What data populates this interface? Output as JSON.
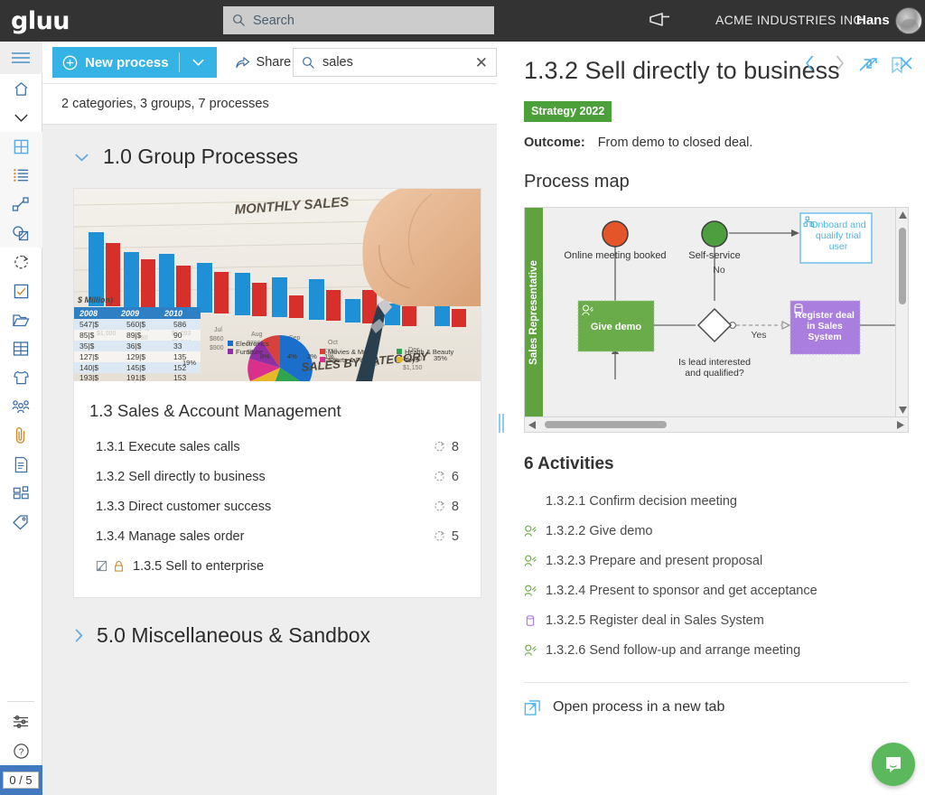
{
  "topbar": {
    "logo": "gluu",
    "search_placeholder": "Search",
    "company": "ACME INDUSTRIES INC.",
    "username": "Hans"
  },
  "rail": {
    "items": [
      {
        "name": "menu-toggle",
        "icon": "hamburger-icon"
      },
      {
        "name": "home",
        "icon": "home-icon"
      },
      {
        "name": "collapse",
        "icon": "chevron-down-icon"
      },
      {
        "name": "processes-grid",
        "icon": "grid-icon"
      },
      {
        "name": "list",
        "icon": "list-icon"
      },
      {
        "name": "flow",
        "icon": "flow-icon"
      },
      {
        "name": "objects",
        "icon": "shapes-icon"
      },
      {
        "name": "activity-cycle",
        "icon": "circular-arrow-icon"
      },
      {
        "name": "tasks",
        "icon": "checkbox-icon"
      },
      {
        "name": "folders",
        "icon": "folder-icon"
      },
      {
        "name": "library",
        "icon": "drawer-icon"
      },
      {
        "name": "roles",
        "icon": "shirt-icon"
      },
      {
        "name": "people",
        "icon": "people-icon"
      },
      {
        "name": "attachments",
        "icon": "paperclip-icon"
      },
      {
        "name": "documents",
        "icon": "document-icon"
      },
      {
        "name": "modules",
        "icon": "modules-icon"
      },
      {
        "name": "tags",
        "icon": "tag-icon"
      }
    ],
    "bottom": [
      {
        "name": "settings",
        "icon": "sliders-icon"
      },
      {
        "name": "help",
        "icon": "question-circle-icon"
      }
    ],
    "counter": "0 / 5"
  },
  "toolbar": {
    "new_process": "New process",
    "share": "Share",
    "search_value": "sales"
  },
  "list": {
    "summary": "2 categories, 3 groups, 7 processes",
    "categories": [
      {
        "id": "cat-1",
        "title": "1.0 Group Processes",
        "expanded": true,
        "groups": [
          {
            "title": "1.3 Sales & Account Management",
            "image_alt": "MONTHLY SALES bar chart with pen",
            "processes": [
              {
                "title": "1.3.1 Execute sales calls",
                "count": "8",
                "locked": false,
                "draft": false
              },
              {
                "title": "1.3.2 Sell directly to business",
                "count": "6",
                "locked": false,
                "draft": false
              },
              {
                "title": "1.3.3 Direct customer success",
                "count": "8",
                "locked": false,
                "draft": false
              },
              {
                "title": "1.3.4 Manage sales order",
                "count": "5",
                "locked": false,
                "draft": false
              },
              {
                "title": "1.3.5 Sell to enterprise",
                "count": "",
                "locked": true,
                "draft": true
              }
            ]
          }
        ]
      },
      {
        "id": "cat-5",
        "title": "5.0 Miscellaneous & Sandbox",
        "expanded": false,
        "groups": []
      }
    ]
  },
  "detail": {
    "title": "1.3.2 Sell directly to business",
    "badge": "Strategy 2022",
    "outcome_label": "Outcome:",
    "outcome_text": "From demo to closed deal.",
    "map_title": "Process map",
    "activities_title": "6 Activities",
    "activities": [
      {
        "num_title": "1.3.2.1 Confirm decision meeting",
        "icon": "none"
      },
      {
        "num_title": "1.3.2.2 Give demo",
        "icon": "user-task-icon"
      },
      {
        "num_title": "1.3.2.3 Prepare and present proposal",
        "icon": "user-task-icon"
      },
      {
        "num_title": "1.3.2.4 Present to sponsor and get acceptance",
        "icon": "user-task-icon"
      },
      {
        "num_title": "1.3.2.5 Register deal in Sales System",
        "icon": "system-task-icon"
      },
      {
        "num_title": "1.3.2.6 Send follow-up and arrange meeting",
        "icon": "user-task-icon"
      }
    ],
    "open_in_new_tab": "Open process in a new tab",
    "nav": {
      "prev": "prev",
      "next": "next",
      "expand": "expand",
      "close": "close"
    }
  },
  "process_map": {
    "lane": "Sales Representative",
    "nodes": [
      {
        "id": "start1",
        "type": "start-event",
        "label": "Online meeting booked",
        "color": "#e4562a"
      },
      {
        "id": "start2",
        "type": "start-event",
        "label": "Self-service",
        "color": "#4d9e3f"
      },
      {
        "id": "task1",
        "type": "user-task",
        "label": "Give demo",
        "color": "#6aab4a"
      },
      {
        "id": "gw1",
        "type": "gateway",
        "label": "Is lead interested and qualified?",
        "color": "#ffffff"
      },
      {
        "id": "task2",
        "type": "system-task",
        "label": "Register deal in Sales System",
        "color": "#a97ede"
      },
      {
        "id": "link1",
        "type": "linked-process",
        "label": "Onboard and qualify trial user",
        "color": "#ffffff"
      }
    ],
    "edge_labels": [
      "No",
      "Yes"
    ]
  },
  "colors": {
    "accent_blue": "#34b3e4",
    "dark_header": "#333333",
    "badge_green": "#4ca03a",
    "lane_green": "#5ea33e",
    "task_green": "#6aab4a",
    "task_purple": "#a97ede",
    "start_orange": "#e4562a",
    "start_green": "#4d9e3f",
    "counter_blue": "#4178be",
    "bubble_green": "#5cb85c"
  }
}
